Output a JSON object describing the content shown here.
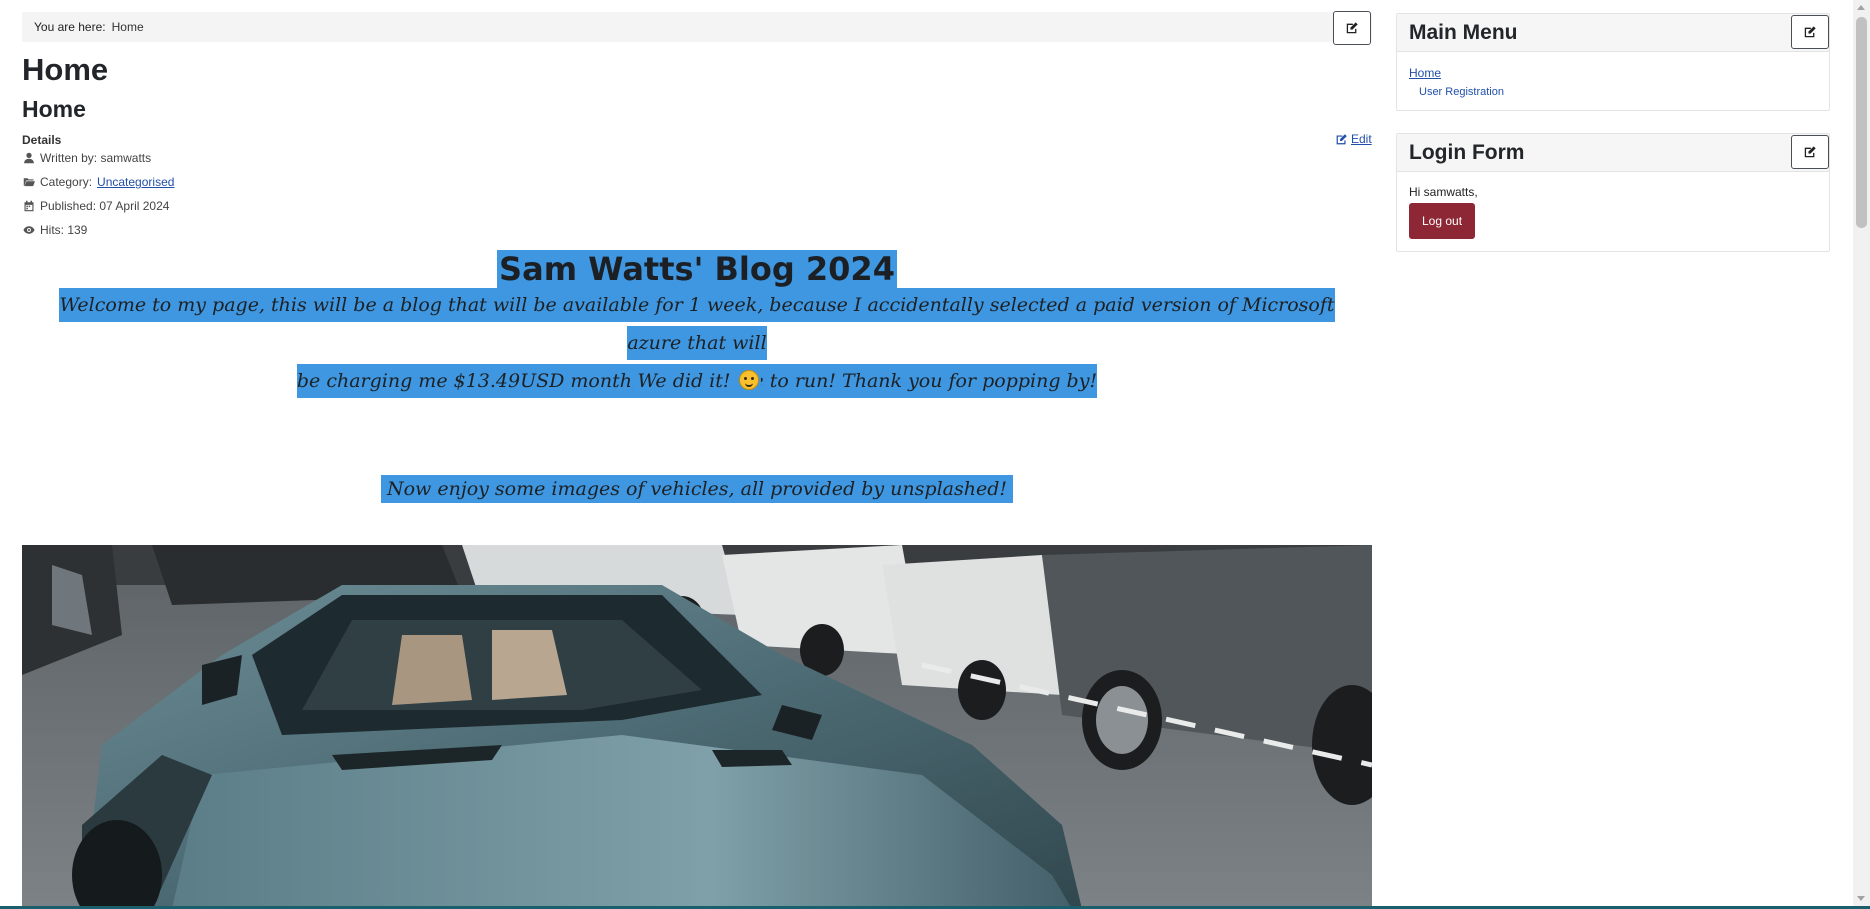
{
  "breadcrumb": {
    "label": "You are here:",
    "current": "Home"
  },
  "page": {
    "title": "Home",
    "article_title": "Home",
    "details_label": "Details",
    "edit_label": "Edit"
  },
  "meta": {
    "written_by": "Written by: samwatts",
    "category_label": "Category:",
    "category_value": "Uncategorised",
    "published": "Published: 07 April 2024",
    "hits": "Hits: 139"
  },
  "article": {
    "title": "Sam Watts' Blog 2024",
    "welcome_line1": "Welcome to my page, this will be a blog that will be available for 1 week, because I accidentally selected a paid version of Microsoft azure that will",
    "welcome_line2": "be charging me $13.49USD monthly to continue to run! Thank you for popping by!",
    "did_it": "We did it!",
    "enjoy": "Now enjoy some images of vehicles, all provided by unsplashed!"
  },
  "sidebar": {
    "main_menu": {
      "title": "Main Menu",
      "items": [
        {
          "label": "Home"
        },
        {
          "label": "User Registration"
        }
      ]
    },
    "login_form": {
      "title": "Login Form",
      "greeting": "Hi samwatts,",
      "logout_label": "Log out"
    }
  },
  "colors": {
    "highlight": "#3e97e0",
    "link": "#224faa",
    "logout_button": "#8e2735"
  },
  "icons": [
    "edit-icon",
    "user-icon",
    "folder-icon",
    "calendar-icon",
    "eye-icon",
    "upside-down-face-emoji"
  ]
}
